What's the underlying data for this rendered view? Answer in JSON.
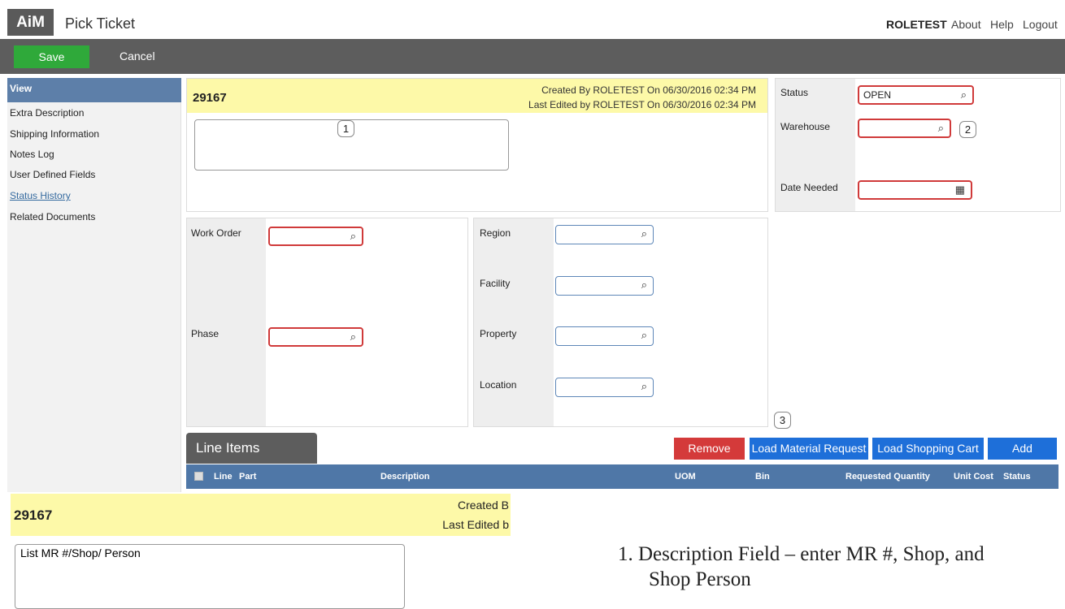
{
  "app": {
    "logo": "AiM",
    "title": "Pick Ticket"
  },
  "topnav": {
    "user": "ROLETEST",
    "about": "About",
    "help": "Help",
    "logout": "Logout"
  },
  "toolbar": {
    "save": "Save",
    "cancel": "Cancel"
  },
  "sidebar": {
    "header": "View",
    "items": [
      {
        "label": "Extra Description"
      },
      {
        "label": "Shipping Information"
      },
      {
        "label": "Notes Log"
      },
      {
        "label": "User Defined Fields"
      },
      {
        "label": "Status History"
      },
      {
        "label": "Related Documents"
      }
    ]
  },
  "header": {
    "ticket_number": "29167",
    "created": "Created By ROLETEST On 06/30/2016 02:34 PM",
    "edited": "Last Edited by ROLETEST On 06/30/2016 02:34 PM",
    "description_value": ""
  },
  "status_panel": {
    "status_label": "Status",
    "status_value": "OPEN",
    "warehouse_label": "Warehouse",
    "warehouse_value": "",
    "date_needed_label": "Date Needed",
    "date_needed_value": ""
  },
  "work_panel": {
    "work_order_label": "Work Order",
    "phase_label": "Phase"
  },
  "location_panel": {
    "region_label": "Region",
    "facility_label": "Facility",
    "property_label": "Property",
    "location_label": "Location"
  },
  "callouts": [
    "1",
    "2",
    "3"
  ],
  "line_items": {
    "tab": "Line Items",
    "remove": "Remove",
    "load_mr": "Load Material Request",
    "load_cart": "Load Shopping Cart",
    "add": "Add",
    "columns": [
      "Line",
      "Part",
      "Description",
      "UOM",
      "Bin",
      "Requested Quantity",
      "Unit Cost",
      "Status"
    ]
  },
  "zoom": {
    "ticket_number": "29167",
    "created_partial": "Created B",
    "edited_partial": "Last Edited b",
    "description_value": "List MR #/Shop/ Person"
  },
  "instruction": {
    "line1": "1.  Description Field – enter MR #, Shop, and",
    "line2": "Shop Person"
  },
  "colors": {
    "save": "#2fa93a",
    "remove": "#d43a3a",
    "action_blue": "#1e6fd9",
    "header_blue": "#4f77a7",
    "yellow": "#fdf9a8",
    "required_red": "#d03a3a"
  }
}
